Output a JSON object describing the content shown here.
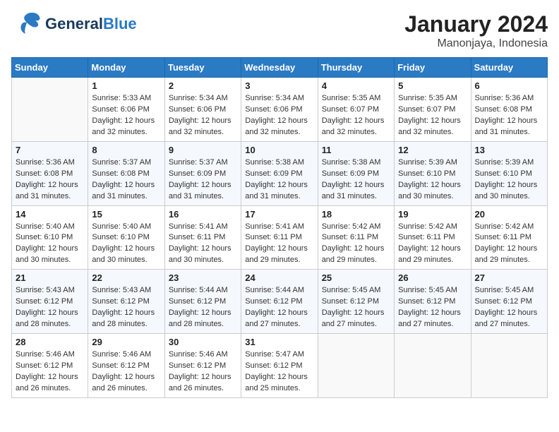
{
  "header": {
    "logo_general": "General",
    "logo_blue": "Blue",
    "title": "January 2024",
    "subtitle": "Manonjaya, Indonesia"
  },
  "calendar": {
    "days_of_week": [
      "Sunday",
      "Monday",
      "Tuesday",
      "Wednesday",
      "Thursday",
      "Friday",
      "Saturday"
    ],
    "weeks": [
      [
        {
          "day": "",
          "info": ""
        },
        {
          "day": "1",
          "info": "Sunrise: 5:33 AM\nSunset: 6:06 PM\nDaylight: 12 hours\nand 32 minutes."
        },
        {
          "day": "2",
          "info": "Sunrise: 5:34 AM\nSunset: 6:06 PM\nDaylight: 12 hours\nand 32 minutes."
        },
        {
          "day": "3",
          "info": "Sunrise: 5:34 AM\nSunset: 6:06 PM\nDaylight: 12 hours\nand 32 minutes."
        },
        {
          "day": "4",
          "info": "Sunrise: 5:35 AM\nSunset: 6:07 PM\nDaylight: 12 hours\nand 32 minutes."
        },
        {
          "day": "5",
          "info": "Sunrise: 5:35 AM\nSunset: 6:07 PM\nDaylight: 12 hours\nand 32 minutes."
        },
        {
          "day": "6",
          "info": "Sunrise: 5:36 AM\nSunset: 6:08 PM\nDaylight: 12 hours\nand 31 minutes."
        }
      ],
      [
        {
          "day": "7",
          "info": "Sunrise: 5:36 AM\nSunset: 6:08 PM\nDaylight: 12 hours\nand 31 minutes."
        },
        {
          "day": "8",
          "info": "Sunrise: 5:37 AM\nSunset: 6:08 PM\nDaylight: 12 hours\nand 31 minutes."
        },
        {
          "day": "9",
          "info": "Sunrise: 5:37 AM\nSunset: 6:09 PM\nDaylight: 12 hours\nand 31 minutes."
        },
        {
          "day": "10",
          "info": "Sunrise: 5:38 AM\nSunset: 6:09 PM\nDaylight: 12 hours\nand 31 minutes."
        },
        {
          "day": "11",
          "info": "Sunrise: 5:38 AM\nSunset: 6:09 PM\nDaylight: 12 hours\nand 31 minutes."
        },
        {
          "day": "12",
          "info": "Sunrise: 5:39 AM\nSunset: 6:10 PM\nDaylight: 12 hours\nand 30 minutes."
        },
        {
          "day": "13",
          "info": "Sunrise: 5:39 AM\nSunset: 6:10 PM\nDaylight: 12 hours\nand 30 minutes."
        }
      ],
      [
        {
          "day": "14",
          "info": "Sunrise: 5:40 AM\nSunset: 6:10 PM\nDaylight: 12 hours\nand 30 minutes."
        },
        {
          "day": "15",
          "info": "Sunrise: 5:40 AM\nSunset: 6:10 PM\nDaylight: 12 hours\nand 30 minutes."
        },
        {
          "day": "16",
          "info": "Sunrise: 5:41 AM\nSunset: 6:11 PM\nDaylight: 12 hours\nand 30 minutes."
        },
        {
          "day": "17",
          "info": "Sunrise: 5:41 AM\nSunset: 6:11 PM\nDaylight: 12 hours\nand 29 minutes."
        },
        {
          "day": "18",
          "info": "Sunrise: 5:42 AM\nSunset: 6:11 PM\nDaylight: 12 hours\nand 29 minutes."
        },
        {
          "day": "19",
          "info": "Sunrise: 5:42 AM\nSunset: 6:11 PM\nDaylight: 12 hours\nand 29 minutes."
        },
        {
          "day": "20",
          "info": "Sunrise: 5:42 AM\nSunset: 6:11 PM\nDaylight: 12 hours\nand 29 minutes."
        }
      ],
      [
        {
          "day": "21",
          "info": "Sunrise: 5:43 AM\nSunset: 6:12 PM\nDaylight: 12 hours\nand 28 minutes."
        },
        {
          "day": "22",
          "info": "Sunrise: 5:43 AM\nSunset: 6:12 PM\nDaylight: 12 hours\nand 28 minutes."
        },
        {
          "day": "23",
          "info": "Sunrise: 5:44 AM\nSunset: 6:12 PM\nDaylight: 12 hours\nand 28 minutes."
        },
        {
          "day": "24",
          "info": "Sunrise: 5:44 AM\nSunset: 6:12 PM\nDaylight: 12 hours\nand 27 minutes."
        },
        {
          "day": "25",
          "info": "Sunrise: 5:45 AM\nSunset: 6:12 PM\nDaylight: 12 hours\nand 27 minutes."
        },
        {
          "day": "26",
          "info": "Sunrise: 5:45 AM\nSunset: 6:12 PM\nDaylight: 12 hours\nand 27 minutes."
        },
        {
          "day": "27",
          "info": "Sunrise: 5:45 AM\nSunset: 6:12 PM\nDaylight: 12 hours\nand 27 minutes."
        }
      ],
      [
        {
          "day": "28",
          "info": "Sunrise: 5:46 AM\nSunset: 6:12 PM\nDaylight: 12 hours\nand 26 minutes."
        },
        {
          "day": "29",
          "info": "Sunrise: 5:46 AM\nSunset: 6:12 PM\nDaylight: 12 hours\nand 26 minutes."
        },
        {
          "day": "30",
          "info": "Sunrise: 5:46 AM\nSunset: 6:12 PM\nDaylight: 12 hours\nand 26 minutes."
        },
        {
          "day": "31",
          "info": "Sunrise: 5:47 AM\nSunset: 6:12 PM\nDaylight: 12 hours\nand 25 minutes."
        },
        {
          "day": "",
          "info": ""
        },
        {
          "day": "",
          "info": ""
        },
        {
          "day": "",
          "info": ""
        }
      ]
    ]
  }
}
